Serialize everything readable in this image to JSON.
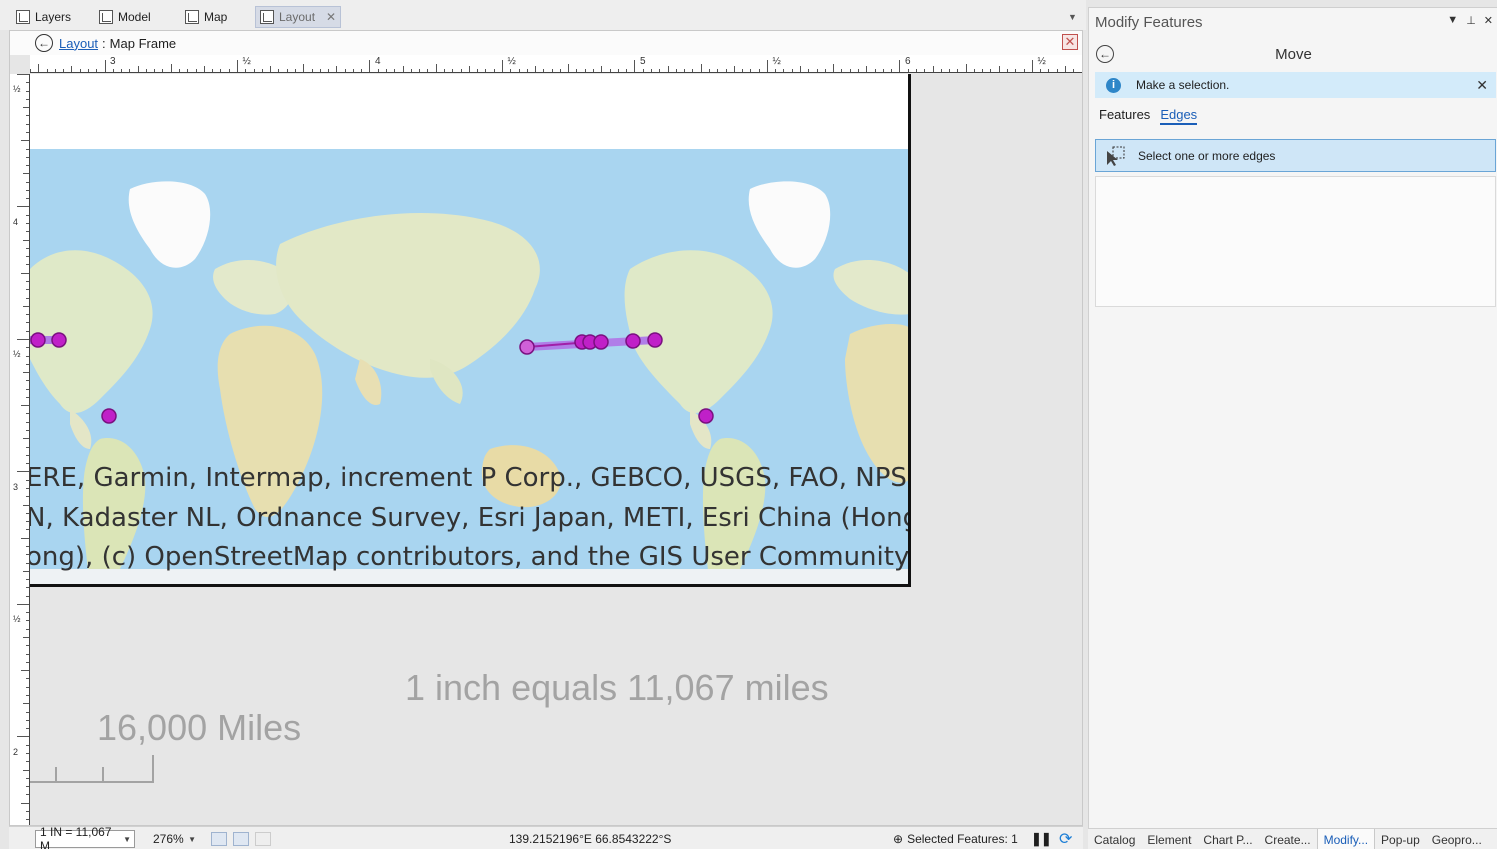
{
  "tabs": [
    {
      "label": "Layers",
      "icon": "layers-icon"
    },
    {
      "label": "Model",
      "icon": "model-icon"
    },
    {
      "label": "Map",
      "icon": "map-icon"
    },
    {
      "label": "Layout",
      "icon": "layout-icon"
    }
  ],
  "breadcrumb": {
    "link": "Layout",
    "separator": ":",
    "current": "Map Frame"
  },
  "ruler": {
    "h_labels": [
      "3",
      "½",
      "4",
      "½",
      "5",
      "½",
      "6",
      "½"
    ],
    "v_labels": [
      "½",
      "4",
      "½",
      "3",
      "½",
      "2"
    ]
  },
  "map": {
    "credits": [
      "ERE, Garmin, Intermap, increment P Corp., GEBCO, USGS, FAO, NPS,",
      "N, Kadaster NL, Ordnance Survey, Esri Japan, METI, Esri China (Hong",
      "ong), (c) OpenStreetMap contributors, and the GIS User Community"
    ],
    "feature_color": "#c020c8",
    "selected_color": "#b07ee8"
  },
  "scale_text": "1 inch equals 11,067 miles",
  "scalebar_label": "16,000 Miles",
  "status": {
    "scale": "1 IN = 11,067 M",
    "zoom": "276%",
    "coords": "139.2152196°E 66.8543222°S",
    "selected_features": "Selected Features: 1"
  },
  "pane": {
    "title": "Modify Features",
    "heading": "Move",
    "info": "Make a selection.",
    "subtabs": [
      "Features",
      "Edges"
    ],
    "select_button": "Select one or more edges"
  },
  "bottom_tabs": [
    "Catalog",
    "Element",
    "Chart P...",
    "Create...",
    "Modify...",
    "Pop-up",
    "Geopro..."
  ]
}
